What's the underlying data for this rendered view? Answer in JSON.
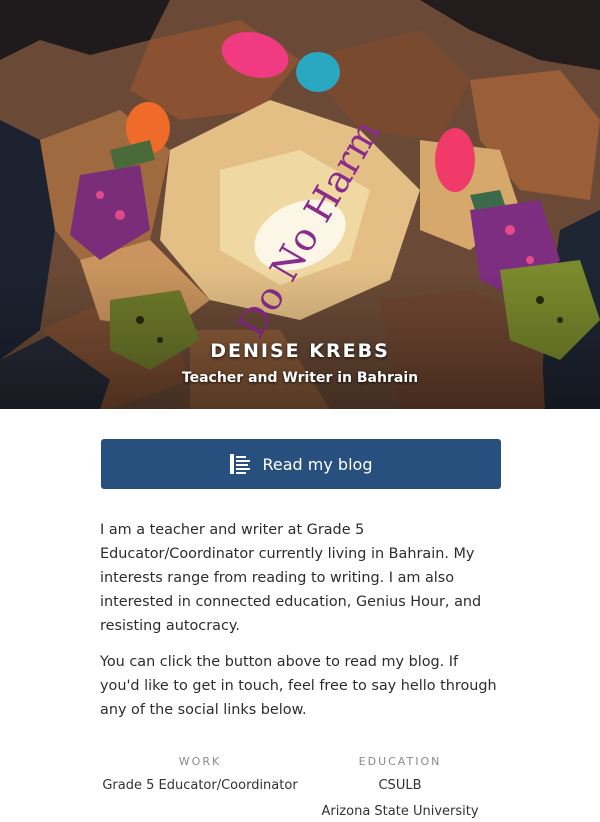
{
  "profile": {
    "name": "DENISE KREBS",
    "tagline": "Teacher and Writer in Bahrain",
    "cover_text": "Do No Harm"
  },
  "blog_button": {
    "label": "Read my blog",
    "icon": "document-lines-icon",
    "color": "#28507f"
  },
  "bio": {
    "paragraphs": [
      "I am a teacher and writer at Grade 5 Educator/Coordinator currently living in Bahrain. My interests range from reading to writing. I am also interested in connected education, Genius Hour, and resisting autocracy.",
      "You can click the button above to read my blog. If you'd like to get in touch, feel free to say hello through any of the social links below."
    ]
  },
  "work": {
    "heading": "WORK",
    "items": [
      "Grade 5 Educator/Coordinator"
    ]
  },
  "education": {
    "heading": "EDUCATION",
    "items": [
      "CSULB",
      "Arizona State University"
    ]
  }
}
